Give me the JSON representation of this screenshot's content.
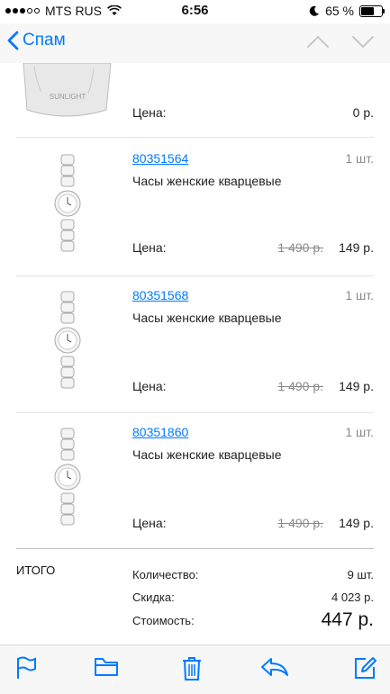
{
  "status": {
    "carrier": "MTS RUS",
    "time": "6:56",
    "battery": "65 %",
    "battery_level": 0.65
  },
  "nav": {
    "back_label": "Спам"
  },
  "partial_item": {
    "price_label": "Цена:",
    "price": "0 р."
  },
  "items": [
    {
      "sku": "80351564",
      "qty": "1 шт.",
      "name": "Часы женские кварцевые",
      "price_label": "Цена:",
      "old_price": "1 490 р.",
      "price": "149 р."
    },
    {
      "sku": "80351568",
      "qty": "1 шт.",
      "name": "Часы женские кварцевые",
      "price_label": "Цена:",
      "old_price": "1 490 р.",
      "price": "149 р."
    },
    {
      "sku": "80351860",
      "qty": "1 шт.",
      "name": "Часы женские кварцевые",
      "price_label": "Цена:",
      "old_price": "1 490 р.",
      "price": "149 р."
    }
  ],
  "totals": {
    "title": "ИТОГО",
    "quantity_label": "Количество:",
    "quantity": "9 шт.",
    "discount_label": "Скидка:",
    "discount": "4 023 р.",
    "cost_label": "Стоимость:",
    "cost": "447 р."
  },
  "toolbar": {
    "icons": [
      "flag-icon",
      "folder-icon",
      "trash-icon",
      "reply-icon",
      "compose-icon"
    ],
    "accent": "#007aff"
  }
}
